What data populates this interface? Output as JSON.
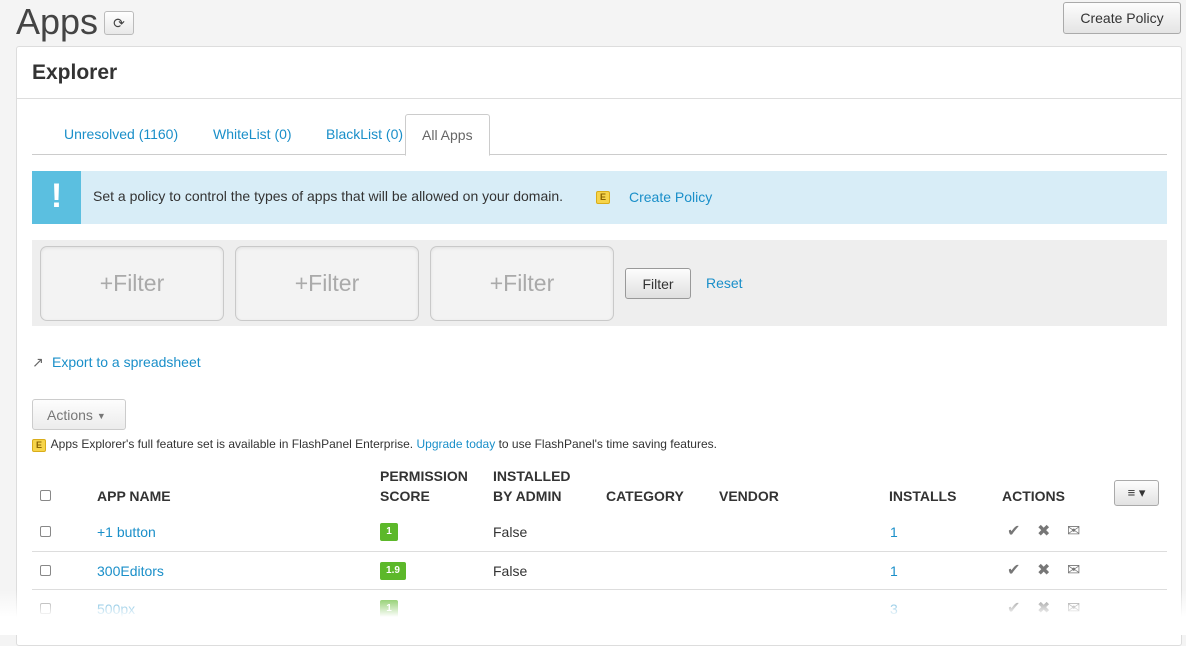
{
  "header": {
    "title": "Apps",
    "refresh_icon": "⟳",
    "create_policy_label": "Create Policy"
  },
  "panel": {
    "title": "Explorer"
  },
  "tabs": [
    {
      "label": "Unresolved (1160)",
      "active": false
    },
    {
      "label": "WhiteList (0)",
      "active": false
    },
    {
      "label": "BlackList (0)",
      "active": false
    },
    {
      "label": "All Apps",
      "active": true
    }
  ],
  "alert": {
    "icon": "!",
    "text": "Set a policy to control the types of apps that will be allowed on your domain.",
    "badge": "E",
    "link": "Create Policy"
  },
  "filters": {
    "boxes": [
      "+Filter",
      "+Filter",
      "+Filter"
    ],
    "filter_button": "Filter",
    "reset_link": "Reset"
  },
  "export": {
    "icon": "↗",
    "label": "Export to a spreadsheet"
  },
  "actions_button": {
    "label": "Actions",
    "caret": "▼"
  },
  "notice": {
    "badge": "E",
    "text_before": "Apps Explorer's full feature set is available in FlashPanel Enterprise.",
    "link": "Upgrade today",
    "text_after": "to use FlashPanel's time saving features."
  },
  "table": {
    "headers": {
      "app_name": "APP NAME",
      "permission_score_1": "PERMISSION",
      "permission_score_2": "SCORE",
      "installed_1": "INSTALLED",
      "installed_2": "BY ADMIN",
      "category": "CATEGORY",
      "vendor": "VENDOR",
      "installs": "INSTALLS",
      "actions": "ACTIONS"
    },
    "column_menu_icon": "≡ ▾",
    "action_icons": {
      "approve": "✔",
      "block": "✖",
      "email": "✉"
    },
    "rows": [
      {
        "name": "+1 button",
        "score": "1",
        "installed_by_admin": "False",
        "category": "",
        "vendor": "",
        "installs": "1"
      },
      {
        "name": "300Editors",
        "score": "1.9",
        "installed_by_admin": "False",
        "category": "",
        "vendor": "",
        "installs": "1"
      },
      {
        "name": "500px",
        "score": "1",
        "installed_by_admin": "",
        "category": "",
        "vendor": "",
        "installs": "3"
      }
    ]
  },
  "colors": {
    "accent": "#1a8fc9",
    "score_green": "#5cb82a",
    "alert_bg": "#d8edf7",
    "alert_icon_bg": "#5bbfe0"
  }
}
